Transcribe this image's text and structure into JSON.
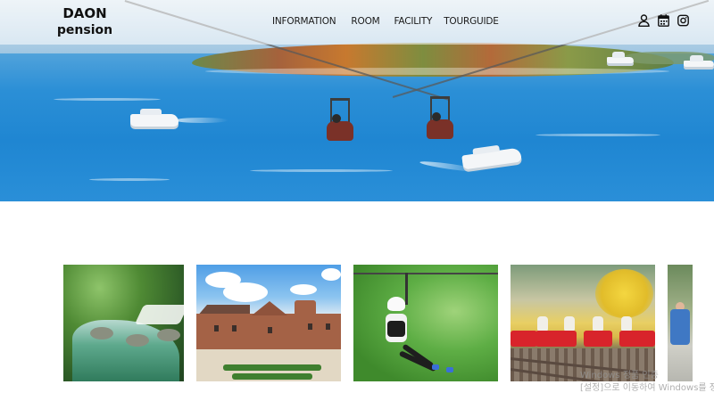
{
  "brand": {
    "line1": "DAON",
    "line2": "pension"
  },
  "nav": {
    "items": [
      {
        "label": "INFORMATION"
      },
      {
        "label": "ROOM"
      },
      {
        "label": "FACILITY"
      },
      {
        "label": "TOURGUIDE"
      }
    ]
  },
  "header_icons": [
    {
      "name": "user-icon"
    },
    {
      "name": "calendar-icon"
    },
    {
      "name": "instagram-icon"
    }
  ],
  "hero": {
    "image": "zipline-over-lake-photo",
    "accent_color": "#2a8fd8"
  },
  "gallery": {
    "thumbnails": [
      {
        "name": "valley-stream-photo"
      },
      {
        "name": "brick-building-garden-photo"
      },
      {
        "name": "zipline-rider-photo"
      },
      {
        "name": "rail-bike-photo"
      },
      {
        "name": "people-street-photo"
      }
    ]
  },
  "watermark": {
    "line1": "Windows 정품 인증",
    "line2": "[설정]으로 이동하여 Windows를 정품 인"
  }
}
